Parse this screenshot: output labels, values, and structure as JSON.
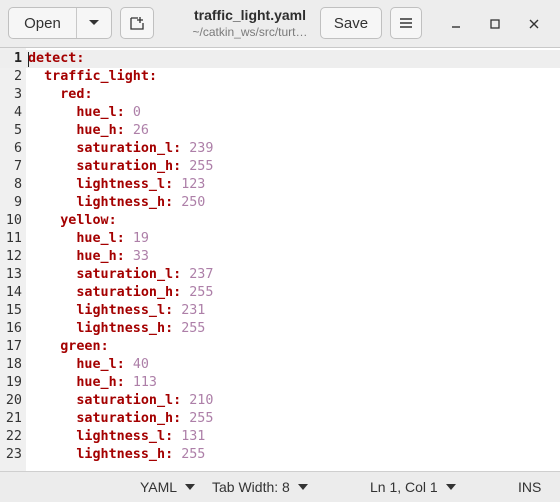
{
  "header": {
    "open_label": "Open",
    "save_label": "Save",
    "title": "traffic_light.yaml",
    "subtitle": "~/catkin_ws/src/turt…",
    "icons": [
      "chevron-down-icon",
      "new-tab-icon",
      "hamburger-menu-icon",
      "minimize-icon",
      "maximize-icon",
      "close-icon"
    ]
  },
  "editor": {
    "lines": [
      {
        "n": "1",
        "indent": "",
        "key": "detect",
        "value": ""
      },
      {
        "n": "2",
        "indent": "  ",
        "key": "traffic_light",
        "value": ""
      },
      {
        "n": "3",
        "indent": "    ",
        "key": "red",
        "value": ""
      },
      {
        "n": "4",
        "indent": "      ",
        "key": "hue_l",
        "value": "0"
      },
      {
        "n": "5",
        "indent": "      ",
        "key": "hue_h",
        "value": "26"
      },
      {
        "n": "6",
        "indent": "      ",
        "key": "saturation_l",
        "value": "239"
      },
      {
        "n": "7",
        "indent": "      ",
        "key": "saturation_h",
        "value": "255"
      },
      {
        "n": "8",
        "indent": "      ",
        "key": "lightness_l",
        "value": "123"
      },
      {
        "n": "9",
        "indent": "      ",
        "key": "lightness_h",
        "value": "250"
      },
      {
        "n": "10",
        "indent": "    ",
        "key": "yellow",
        "value": ""
      },
      {
        "n": "11",
        "indent": "      ",
        "key": "hue_l",
        "value": "19"
      },
      {
        "n": "12",
        "indent": "      ",
        "key": "hue_h",
        "value": "33"
      },
      {
        "n": "13",
        "indent": "      ",
        "key": "saturation_l",
        "value": "237"
      },
      {
        "n": "14",
        "indent": "      ",
        "key": "saturation_h",
        "value": "255"
      },
      {
        "n": "15",
        "indent": "      ",
        "key": "lightness_l",
        "value": "231"
      },
      {
        "n": "16",
        "indent": "      ",
        "key": "lightness_h",
        "value": "255"
      },
      {
        "n": "17",
        "indent": "    ",
        "key": "green",
        "value": ""
      },
      {
        "n": "18",
        "indent": "      ",
        "key": "hue_l",
        "value": "40"
      },
      {
        "n": "19",
        "indent": "      ",
        "key": "hue_h",
        "value": "113"
      },
      {
        "n": "20",
        "indent": "      ",
        "key": "saturation_l",
        "value": "210"
      },
      {
        "n": "21",
        "indent": "      ",
        "key": "saturation_h",
        "value": "255"
      },
      {
        "n": "22",
        "indent": "      ",
        "key": "lightness_l",
        "value": "131"
      },
      {
        "n": "23",
        "indent": "      ",
        "key": "lightness_h",
        "value": "255"
      }
    ]
  },
  "statusbar": {
    "language": "YAML",
    "tab_width": "Tab Width: 8",
    "position": "Ln 1, Col 1",
    "mode": "INS"
  },
  "colors": {
    "key": "#a40000",
    "number": "#ad7fa8",
    "current_line": "#eeeeee",
    "gutter": "#f0f0f0"
  }
}
